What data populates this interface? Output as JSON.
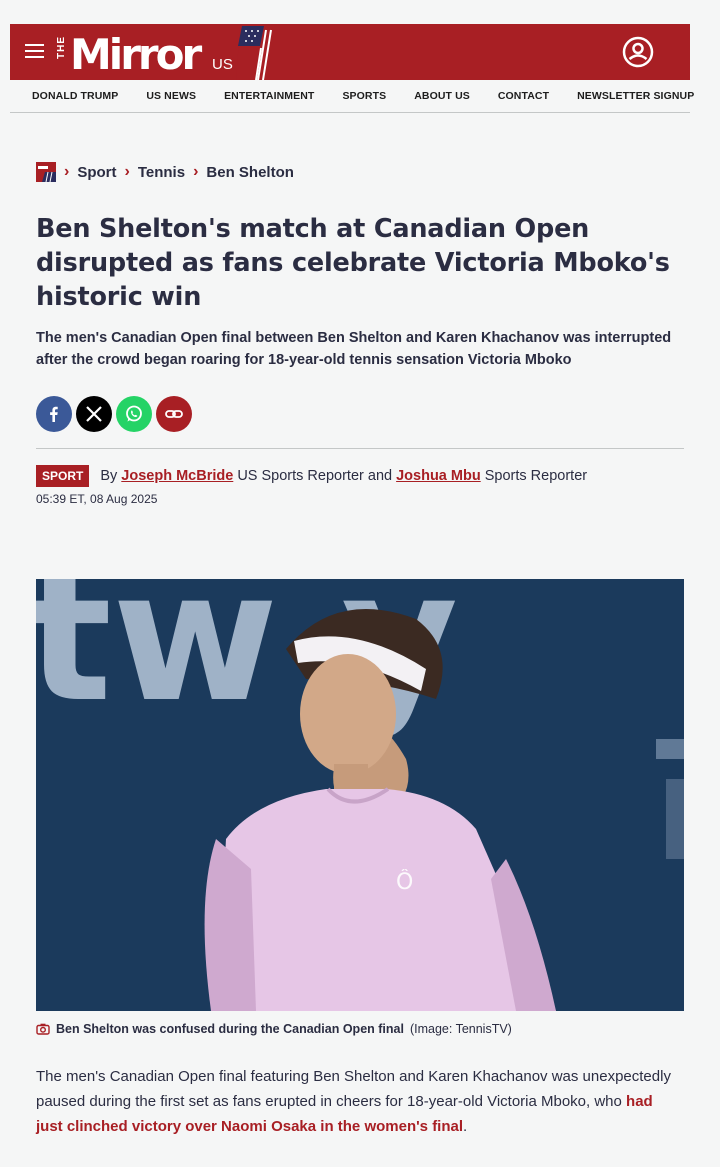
{
  "masthead": {
    "logo_the": "THE",
    "logo_name": "Mirror",
    "logo_us": "US",
    "brand_color": "#a81f24"
  },
  "nav": {
    "items": [
      "DONALD TRUMP",
      "US NEWS",
      "ENTERTAINMENT",
      "SPORTS",
      "ABOUT US",
      "CONTACT",
      "NEWSLETTER SIGNUP"
    ]
  },
  "breadcrumb": {
    "items": [
      "Sport",
      "Tennis",
      "Ben Shelton"
    ]
  },
  "article": {
    "headline": "Ben Shelton's match at Canadian Open disrupted as fans celebrate Victoria Mboko's historic win",
    "standfirst": "The men's Canadian Open final between Ben Shelton and Karen Khachanov was interrupted after the crowd began roaring for 18-year-old tennis sensation Victoria Mboko",
    "tag": "SPORT",
    "by": "By",
    "author1": "Joseph McBride",
    "author1_role": "US Sports Reporter and",
    "author2": "Joshua Mbu",
    "author2_role": "Sports Reporter",
    "date": "05:39 ET, 08 Aug 2025",
    "caption_main": "Ben Shelton was confused during the Canadian Open final",
    "caption_credit": "(Image: TennisTV)",
    "body_part1": "The men's Canadian Open final featuring Ben Shelton and Karen Khachanov was unexpectedly paused during the first set as fans erupted in cheers for 18-year-old Victoria Mboko, who ",
    "body_link": "had just clinched victory over Naomi Osaka in the women's final",
    "body_part2": "."
  },
  "share": {
    "facebook_color": "#3b5998",
    "x_color": "#000000",
    "whatsapp_color": "#25d366",
    "link_color": "#a81f24"
  }
}
